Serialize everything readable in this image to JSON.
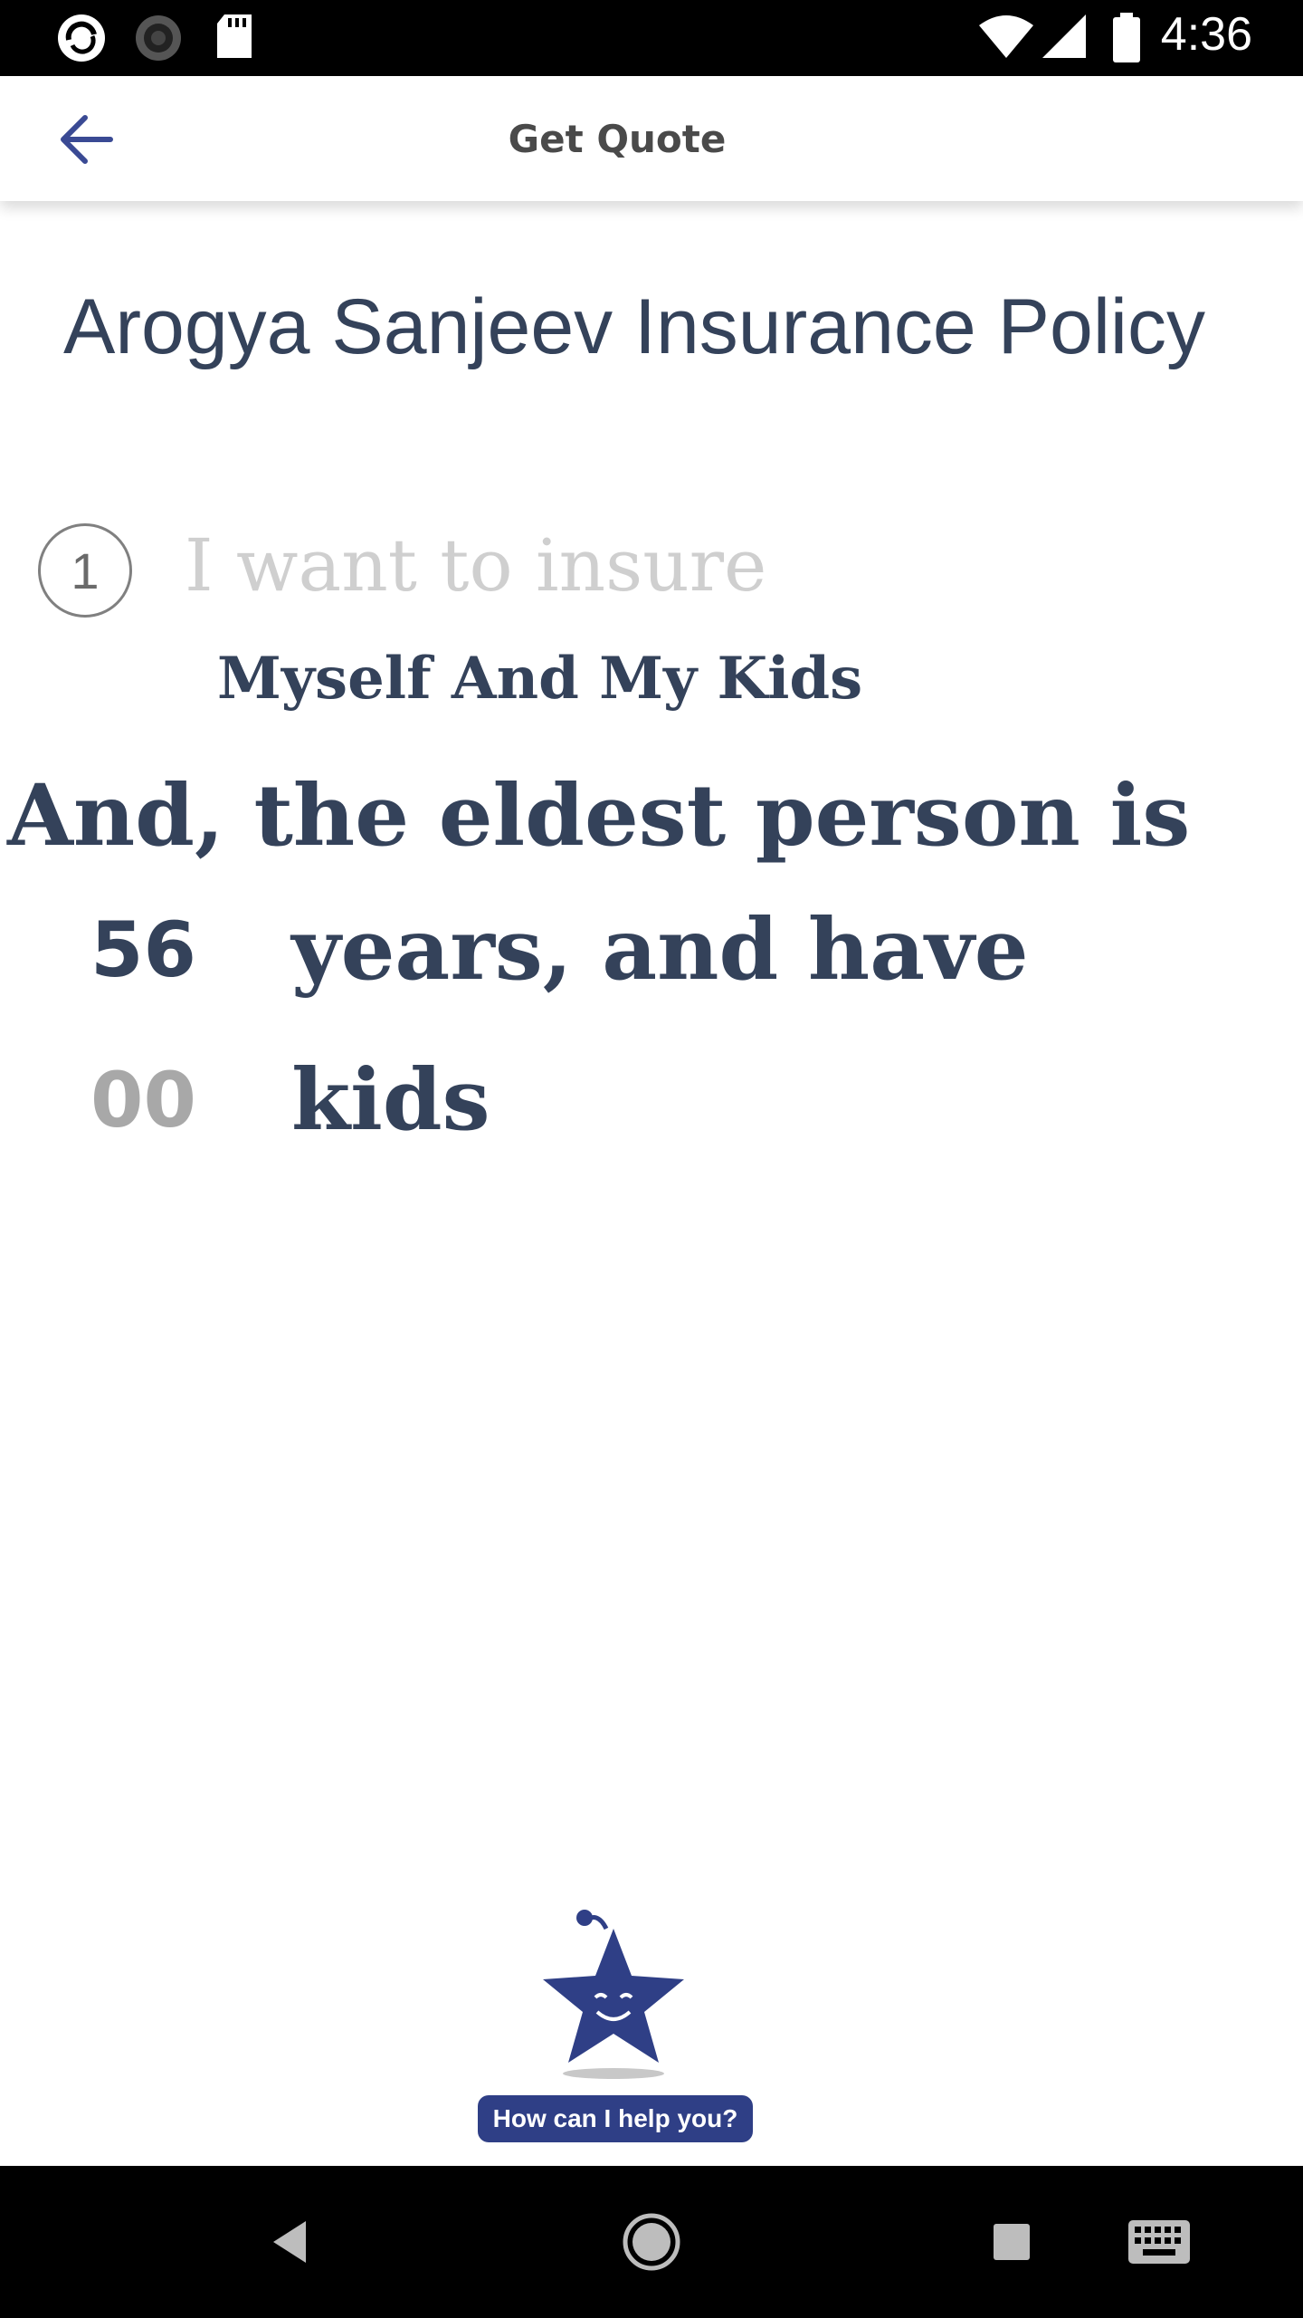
{
  "status_bar": {
    "time": "4:36",
    "icons": [
      "app-notification-icon",
      "loading-icon",
      "sd-card-icon",
      "wifi-icon",
      "signal-icon",
      "battery-icon"
    ]
  },
  "app_bar": {
    "title": "Get Quote",
    "back_icon": "arrow-left-icon"
  },
  "main": {
    "policy_title": "Arogya Sanjeev Insurance Policy",
    "step_number": "1",
    "step_label": "I want to insure",
    "insure_value": "Myself And My Kids",
    "eldest_text": "And, the eldest person is",
    "age_value": "56",
    "years_text": "years, and have",
    "kids_value": "00",
    "kids_text": "kids"
  },
  "helper": {
    "bubble_text": "How can I help you?",
    "mascot_icon": "star-mascot-icon"
  },
  "nav_bar": {
    "icons": [
      "back-triangle-icon",
      "home-circle-icon",
      "recents-square-icon",
      "keyboard-icon"
    ]
  },
  "colors": {
    "text_primary": "#34425a",
    "placeholder": "#cfcfcf",
    "kids_placeholder": "#a8a8a8",
    "accent": "#2f3f86",
    "back_arrow": "#3a4a94"
  }
}
